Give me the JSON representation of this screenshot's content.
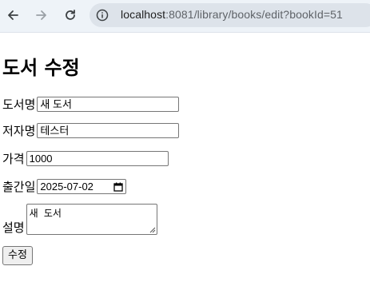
{
  "browser": {
    "url_host": "localhost",
    "url_path": ":8081/library/books/edit?bookId=51"
  },
  "page": {
    "title": "도서 수정"
  },
  "form": {
    "title_label": "도서명",
    "title_value": "새 도서",
    "author_label": "저자명",
    "author_value": "테스터",
    "price_label": "가격",
    "price_value": "1000",
    "published_label": "출간일",
    "published_value": "2025-07-02",
    "description_label": "설명",
    "description_value": "새 도서",
    "submit_label": "수정"
  }
}
